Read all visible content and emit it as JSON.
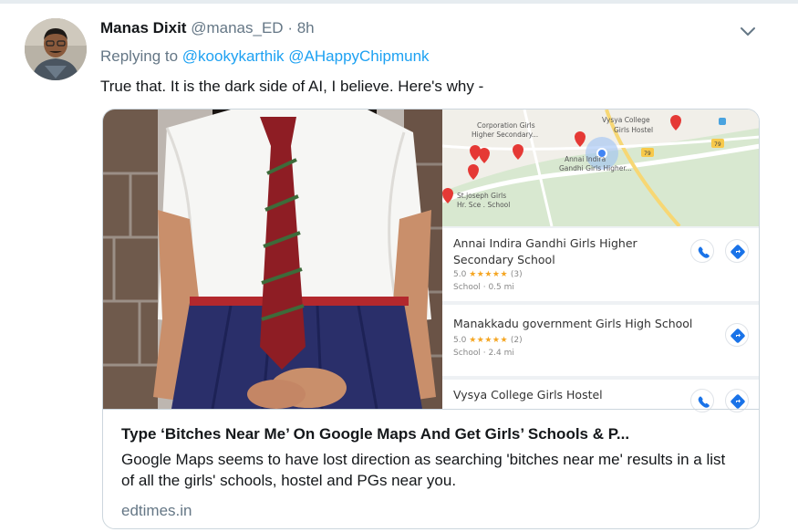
{
  "tweet": {
    "author_name": "Manas Dixit",
    "author_handle": "@manas_ED",
    "separator": "·",
    "time": "8h",
    "replying_prefix": "Replying to",
    "mentions": [
      "@kookykarthik",
      "@AHappyChipmunk"
    ],
    "text": "True that. It is the dark side of AI, I believe. Here's why -"
  },
  "map": {
    "labels": [
      "Corporation Girls",
      "Higher Secondary...",
      "Vysya College",
      "Girls Hostel",
      "Annai Indira",
      "Gandhi Girls Higher...",
      "St.joseph Girls",
      "Hr. Sce . School"
    ],
    "road_numbers": [
      "79",
      "79"
    ]
  },
  "results": [
    {
      "name_line1": "Annai Indira Gandhi Girls Higher",
      "name_line2": "Secondary School",
      "rating": "5.0",
      "stars": "★★★★★",
      "reviews": "(3)",
      "meta": "School · 0.5 mi"
    },
    {
      "name_line1": "Manakkadu government Girls High School",
      "rating": "5.0",
      "stars": "★★★★★",
      "reviews": "(2)",
      "meta": "School · 2.4 mi"
    },
    {
      "name_line1": "Vysya College Girls Hostel"
    }
  ],
  "card": {
    "title": "Type ‘Bitches Near Me’ On Google Maps And Get Girls’ Schools & P...",
    "description": "Google Maps seems to have lost direction as searching 'bitches near me' results in a list of all the girls' schools, hostel and PGs near you.",
    "domain": "edtimes.in"
  },
  "colors": {
    "link": "#1da1f2",
    "muted": "#657786",
    "border": "#ccd6dd",
    "map_pin": "#e53935",
    "star": "#f5a623"
  }
}
